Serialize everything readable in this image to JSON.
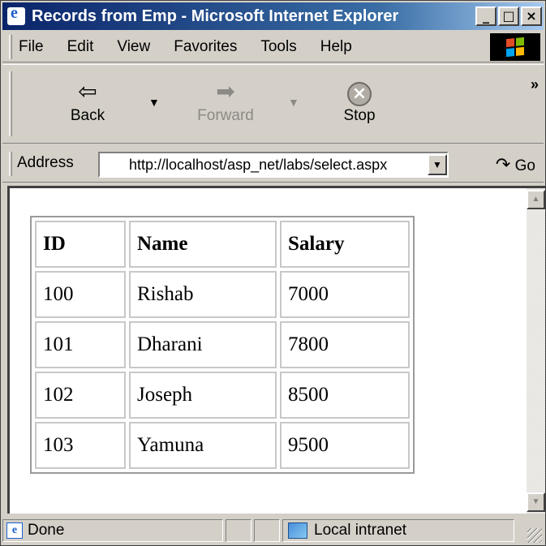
{
  "window": {
    "title": "Records from Emp - Microsoft Internet Explorer",
    "controls": [
      "_",
      "□",
      "×"
    ]
  },
  "menubar": {
    "items": [
      "File",
      "Edit",
      "View",
      "Favorites",
      "Tools",
      "Help"
    ]
  },
  "toolbar": {
    "back_label": "Back",
    "back_icon": "arrow-left",
    "forward_label": "Forward",
    "forward_icon": "arrow-right",
    "stop_label": "Stop",
    "stop_icon": "stop-x",
    "more_glyph": "»"
  },
  "address": {
    "label": "Address",
    "url": "http://localhost/asp_net/labs/select.aspx",
    "go_label": "Go"
  },
  "table": {
    "headers": [
      "ID",
      "Name",
      "Salary"
    ],
    "rows": [
      [
        "100",
        "Rishab",
        "7000"
      ],
      [
        "101",
        "Dharani",
        "7800"
      ],
      [
        "102",
        "Joseph",
        "8500"
      ],
      [
        "103",
        "Yamuna",
        "9500"
      ]
    ]
  },
  "status": {
    "text": "Done",
    "zone": "Local intranet"
  },
  "colors": {
    "titlebar_start": "#0a246a",
    "titlebar_end": "#a6caf0",
    "chrome": "#d4d0c8"
  }
}
